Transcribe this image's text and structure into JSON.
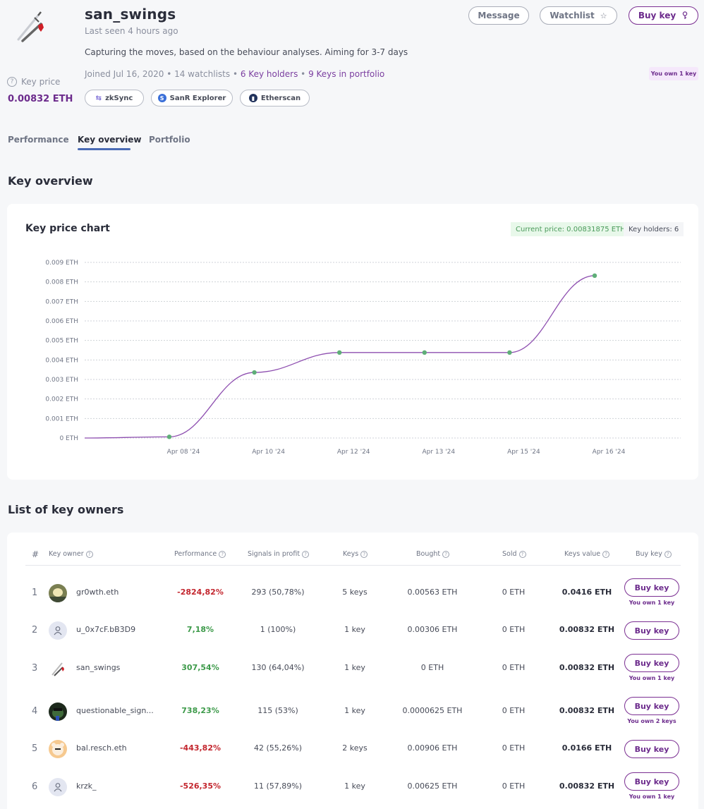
{
  "profile": {
    "name": "san_swings",
    "last_seen": "Last seen 4 hours ago",
    "bio": "Capturing the moves, based on the behaviour analyses. Aiming for 3-7 days",
    "joined": "Joined Jul 16, 2020",
    "watchlists": "14 watchlists",
    "key_holders": "6 Key holders",
    "keys_in_portfolio": "9 Keys in portfolio",
    "separator": " • ",
    "key_price_label": "Key price",
    "key_price_value": "0.00832 ETH",
    "you_own": "You own 1 key"
  },
  "links": [
    {
      "label": "zkSync",
      "icon": "zksync-icon"
    },
    {
      "label": "SanR Explorer",
      "icon": "sanr-icon"
    },
    {
      "label": "Etherscan",
      "icon": "etherscan-icon"
    }
  ],
  "actions": {
    "message": "Message",
    "watchlist": "Watchlist",
    "buy_key": "Buy key"
  },
  "tabs": [
    {
      "label": "Performance",
      "active": false
    },
    {
      "label": "Key overview",
      "active": true
    },
    {
      "label": "Portfolio",
      "active": false
    }
  ],
  "sections": {
    "key_overview": "Key overview",
    "list_of_owners": "List of key owners"
  },
  "chart_card": {
    "title": "Key price chart",
    "current_price": "Current price: 0.00831875 ETH",
    "key_holders": "Key holders: 6"
  },
  "chart_data": {
    "type": "line",
    "title": "Key price chart",
    "xlabel": "",
    "ylabel": "",
    "ylim": [
      0,
      0.009
    ],
    "y_ticks": [
      0,
      0.001,
      0.002,
      0.003,
      0.004,
      0.005,
      0.006,
      0.007,
      0.008,
      0.009
    ],
    "y_tick_labels": [
      "0 ETH",
      "0.001 ETH",
      "0.002 ETH",
      "0.003 ETH",
      "0.004 ETH",
      "0.005 ETH",
      "0.006 ETH",
      "0.007 ETH",
      "0.008 ETH",
      "0.009 ETH"
    ],
    "categories": [
      "Apr 08 '24",
      "Apr 10 '24",
      "Apr 12 '24",
      "Apr 13 '24",
      "Apr 15 '24",
      "Apr 16 '24"
    ],
    "grid": true,
    "legend": "none",
    "series": [
      {
        "name": "Key price",
        "start_value": 0.0,
        "values": [
          6e-05,
          0.00336,
          0.00438,
          0.00438,
          0.00438,
          0.00832
        ],
        "line_color": "#8e4fb0",
        "marker_color": "#5fae78"
      }
    ]
  },
  "table": {
    "headers": {
      "index": "#",
      "owner": "Key owner",
      "performance": "Performance",
      "signals": "Signals in profit",
      "keys": "Keys",
      "bought": "Bought",
      "sold": "Sold",
      "value": "Keys value",
      "buy": "Buy key"
    },
    "rows": [
      {
        "index": "1",
        "owner": "gr0wth.eth",
        "avatar": "duck",
        "performance": "-2824,82%",
        "perf_sign": "neg",
        "signals": "293 (50,78%)",
        "keys": "5 keys",
        "bought": "0.00563 ETH",
        "sold": "0 ETH",
        "value": "0.0416 ETH",
        "buy": "Buy key",
        "own": "You own 1 key"
      },
      {
        "index": "2",
        "owner": "u_0x7cF.bB3D9",
        "avatar": "default",
        "performance": "7,18%",
        "perf_sign": "pos",
        "signals": "1 (100%)",
        "keys": "1 key",
        "bought": "0.00306 ETH",
        "sold": "0 ETH",
        "value": "0.00832 ETH",
        "buy": "Buy key",
        "own": ""
      },
      {
        "index": "3",
        "owner": "san_swings",
        "avatar": "sword",
        "performance": "307,54%",
        "perf_sign": "pos",
        "signals": "130 (64,04%)",
        "keys": "1 key",
        "bought": "0 ETH",
        "sold": "0 ETH",
        "value": "0.00832 ETH",
        "buy": "Buy key",
        "own": "You own 1 key"
      },
      {
        "index": "4",
        "owner": "questionable_sign...",
        "avatar": "dark",
        "performance": "738,23%",
        "perf_sign": "pos",
        "signals": "115 (53%)",
        "keys": "1 key",
        "bought": "0.0000625 ETH",
        "sold": "0 ETH",
        "value": "0.00832 ETH",
        "buy": "Buy key",
        "own": "You own 2 keys"
      },
      {
        "index": "5",
        "owner": "bal.resch.eth",
        "avatar": "bear",
        "performance": "-443,82%",
        "perf_sign": "neg",
        "signals": "42 (55,26%)",
        "keys": "2 keys",
        "bought": "0.00906 ETH",
        "sold": "0 ETH",
        "value": "0.0166 ETH",
        "buy": "Buy key",
        "own": ""
      },
      {
        "index": "6",
        "owner": "krzk_",
        "avatar": "default",
        "performance": "-526,35%",
        "perf_sign": "neg",
        "signals": "11 (57,89%)",
        "keys": "1 key",
        "bought": "0.00625 ETH",
        "sold": "0 ETH",
        "value": "0.00832 ETH",
        "buy": "Buy key",
        "own": "You own 1 key"
      }
    ]
  },
  "colors": {
    "accent": "#6c2b8c",
    "positive": "#3d9a4a",
    "negative": "#c3262e",
    "tab_underline": "#4a6bb5"
  }
}
